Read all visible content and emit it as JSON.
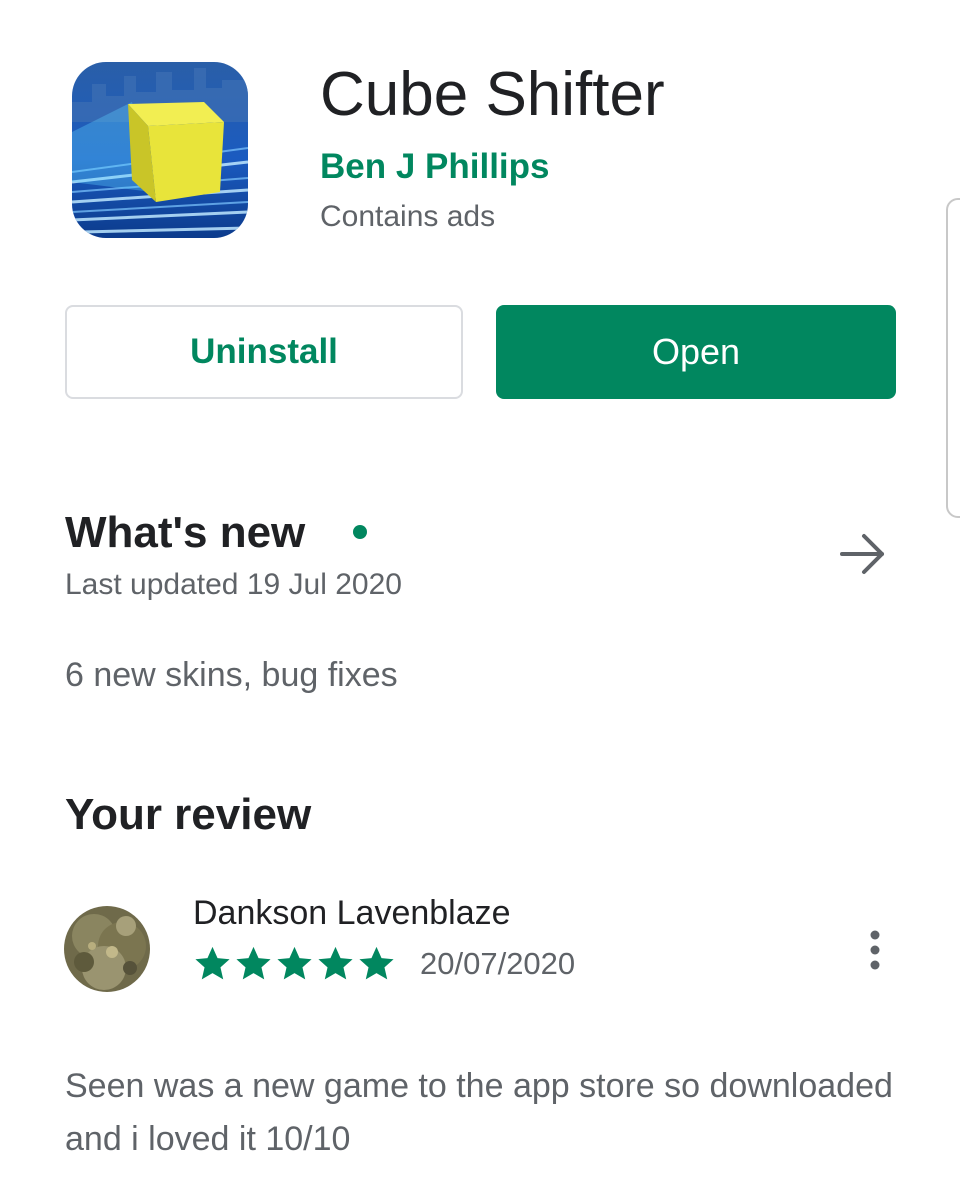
{
  "app": {
    "title": "Cube Shifter",
    "developer": "Ben J Phillips",
    "ads_note": "Contains ads",
    "icon": "cube-shifter-app-icon"
  },
  "actions": {
    "uninstall_label": "Uninstall",
    "open_label": "Open"
  },
  "whats_new": {
    "title": "What's new",
    "last_updated": "Last updated 19 Jul 2020",
    "notes": "6 new skins, bug fixes",
    "arrow_icon": "arrow-right-icon"
  },
  "review": {
    "section_title": "Your review",
    "reviewer_name": "Dankson Lavenblaze",
    "rating": 5,
    "rating_max": 5,
    "date": "20/07/2020",
    "text": "Seen was a new game to the app store so downloaded and i loved it 10/10",
    "menu_icon": "more-vert-icon"
  },
  "colors": {
    "accent": "#01875f",
    "text_primary": "#202124",
    "text_secondary": "#5f6368",
    "border": "#dadce0"
  }
}
